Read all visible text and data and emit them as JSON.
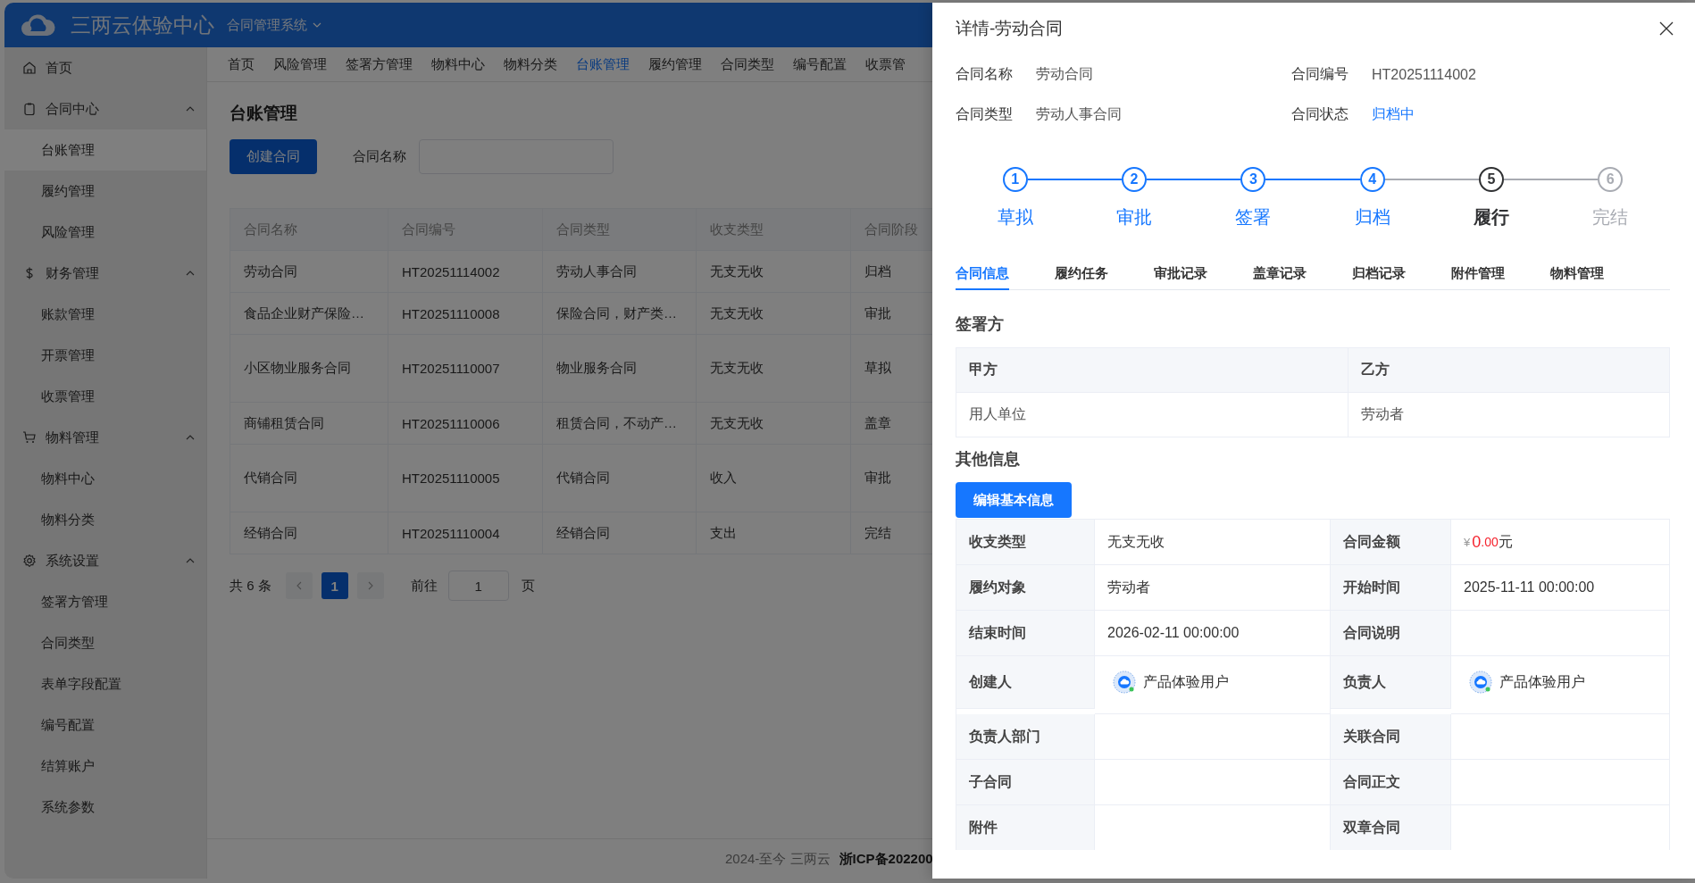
{
  "header": {
    "logo_text": "三两云体验中心",
    "system": "合同管理系统"
  },
  "sidebar": {
    "items": [
      {
        "label": "首页"
      },
      {
        "label": "合同中心",
        "expanded": true,
        "children": [
          {
            "label": "台账管理",
            "selected": true
          },
          {
            "label": "履约管理",
            "selected": false
          },
          {
            "label": "风险管理",
            "selected": false
          }
        ]
      },
      {
        "label": "财务管理",
        "expanded": true,
        "children": [
          {
            "label": "账款管理",
            "selected": false
          },
          {
            "label": "开票管理",
            "selected": false
          },
          {
            "label": "收票管理",
            "selected": false
          }
        ]
      },
      {
        "label": "物料管理",
        "expanded": true,
        "children": [
          {
            "label": "物料中心",
            "selected": false
          },
          {
            "label": "物料分类",
            "selected": false
          }
        ]
      },
      {
        "label": "系统设置",
        "expanded": true,
        "children": [
          {
            "label": "签署方管理",
            "selected": false
          },
          {
            "label": "合同类型",
            "selected": false
          },
          {
            "label": "表单字段配置",
            "selected": false
          },
          {
            "label": "编号配置",
            "selected": false
          },
          {
            "label": "结算账户",
            "selected": false
          },
          {
            "label": "系统参数",
            "selected": false
          }
        ]
      }
    ]
  },
  "nav_tabs": [
    {
      "label": "首页",
      "selected": false
    },
    {
      "label": "风险管理",
      "selected": false
    },
    {
      "label": "签署方管理",
      "selected": false
    },
    {
      "label": "物料中心",
      "selected": false
    },
    {
      "label": "物料分类",
      "selected": false
    },
    {
      "label": "台账管理",
      "selected": true
    },
    {
      "label": "履约管理",
      "selected": false
    },
    {
      "label": "合同类型",
      "selected": false
    },
    {
      "label": "编号配置",
      "selected": false
    },
    {
      "label": "收票管",
      "selected": false
    }
  ],
  "page": {
    "title": "台账管理",
    "create_button": "创建合同",
    "filter_label": "合同名称",
    "table": {
      "columns": [
        "合同名称",
        "合同编号",
        "合同类型",
        "收支类型",
        "合同阶段"
      ],
      "rows": [
        {
          "tall": false,
          "cells": [
            "劳动合同",
            "HT20251114002",
            "劳动人事合同",
            "无支无收",
            "归档"
          ]
        },
        {
          "tall": false,
          "cells": [
            "食品企业财产保险…",
            "HT20251110008",
            "保险合同，财产类…",
            "无支无收",
            "审批"
          ]
        },
        {
          "tall": true,
          "cells": [
            "小区物业服务合同",
            "HT20251110007",
            "物业服务合同",
            "无支无收",
            "草拟"
          ]
        },
        {
          "tall": false,
          "cells": [
            "商铺租赁合同",
            "HT20251110006",
            "租赁合同，不动产…",
            "无支无收",
            "盖章"
          ]
        },
        {
          "tall": true,
          "cells": [
            "代销合同",
            "HT20251110005",
            "代销合同",
            "收入",
            "审批"
          ]
        },
        {
          "tall": false,
          "cells": [
            "经销合同",
            "HT20251110004",
            "经销合同",
            "支出",
            "完结"
          ]
        }
      ]
    },
    "pagination": {
      "total": "共 6 条",
      "pages": [
        {
          "label": "1",
          "selected": true
        }
      ],
      "goto_label": "前往",
      "goto_value": "1",
      "goto_suffix": "页"
    }
  },
  "footer": {
    "copyright": "2024-至今 三两云",
    "icp": "浙ICP备202200"
  },
  "drawer": {
    "title": "详情-劳动合同",
    "summary": [
      {
        "label": "合同名称",
        "value": "劳动合同",
        "kind": "text"
      },
      {
        "label": "合同编号",
        "value": "HT20251114002",
        "kind": "text"
      },
      {
        "label": "合同类型",
        "value": "劳动人事合同",
        "kind": "text"
      },
      {
        "label": "合同状态",
        "value": "归档中",
        "kind": "status"
      }
    ],
    "steps": [
      {
        "number": "1",
        "label": "草拟",
        "done": true,
        "current": false
      },
      {
        "number": "2",
        "label": "审批",
        "done": true,
        "current": false
      },
      {
        "number": "3",
        "label": "签署",
        "done": true,
        "current": false
      },
      {
        "number": "4",
        "label": "归档",
        "done": true,
        "current": false
      },
      {
        "number": "5",
        "label": "履行",
        "done": false,
        "current": true
      },
      {
        "number": "6",
        "label": "完结",
        "done": false,
        "current": false
      }
    ],
    "tabs": [
      {
        "label": "合同信息",
        "selected": true
      },
      {
        "label": "履约任务",
        "selected": false
      },
      {
        "label": "审批记录",
        "selected": false
      },
      {
        "label": "盖章记录",
        "selected": false
      },
      {
        "label": "归档记录",
        "selected": false
      },
      {
        "label": "附件管理",
        "selected": false
      },
      {
        "label": "物料管理",
        "selected": false
      }
    ],
    "parties": {
      "heading": "签署方",
      "columns": [
        "甲方",
        "乙方"
      ],
      "row": [
        "用人单位",
        "劳动者"
      ]
    },
    "other": {
      "heading": "其他信息",
      "edit_button": "编辑基本信息",
      "fields": [
        {
          "label": "收支类型",
          "kind": "text",
          "value": "无支无收"
        },
        {
          "label": "合同金额",
          "kind": "amount",
          "currency": "¥",
          "integer": "0",
          "decimals": ".00",
          "unit": "元"
        },
        {
          "label": "履约对象",
          "kind": "text",
          "value": "劳动者"
        },
        {
          "label": "开始时间",
          "kind": "text",
          "value": "2025-11-11 00:00:00"
        },
        {
          "label": "结束时间",
          "kind": "text",
          "value": "2026-02-11 00:00:00"
        },
        {
          "label": "合同说明",
          "kind": "empty"
        },
        {
          "label": "创建人",
          "kind": "user",
          "value": "产品体验用户"
        },
        {
          "label": "负责人",
          "kind": "user",
          "value": "产品体验用户"
        },
        {
          "label": "负责人部门",
          "kind": "empty"
        },
        {
          "label": "关联合同",
          "kind": "empty"
        },
        {
          "label": "子合同",
          "kind": "empty"
        },
        {
          "label": "合同正文",
          "kind": "empty"
        },
        {
          "label": "附件",
          "kind": "empty"
        },
        {
          "label": "双章合同",
          "kind": "empty"
        }
      ]
    }
  }
}
